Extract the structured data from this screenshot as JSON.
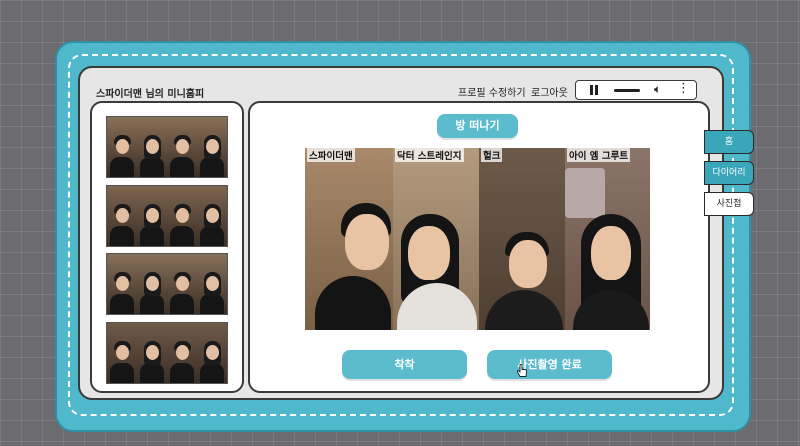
{
  "header": {
    "title": "스파이더맨 님의 미니홈피",
    "edit_profile": "프로필 수정하기",
    "logout": "로그아웃"
  },
  "player": {
    "pause_icon": "pause-icon",
    "volume_icon": "volume-icon",
    "more_icon": "more-vertical-icon"
  },
  "main": {
    "leave_button": "방 떠나기",
    "wear_button": "착착",
    "done_button": "사진촬영 완료",
    "participants": [
      {
        "label": "스파이더맨"
      },
      {
        "label": "닥터 스트레인지"
      },
      {
        "label": "헐크"
      },
      {
        "label": "아이 엠 그루트"
      }
    ]
  },
  "side_tabs": [
    {
      "label": "홈"
    },
    {
      "label": "다이어리"
    },
    {
      "label": "사진첩"
    }
  ],
  "colors": {
    "accent": "#5bbccd",
    "frame": "#4fb8cb",
    "background": "#6b6b70"
  }
}
